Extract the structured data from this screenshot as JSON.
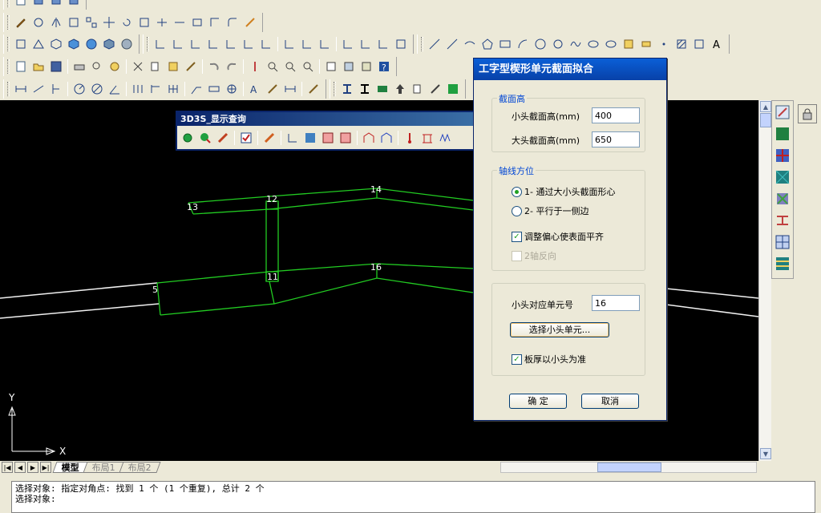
{
  "dialog": {
    "title": "工字型楔形单元截面拟合",
    "section_group": "截面高",
    "small_end_label": "小头截面高(mm)",
    "small_end_value": "400",
    "large_end_label": "大头截面高(mm)",
    "large_end_value": "650",
    "axis_group": "轴线方位",
    "radio1": "1- 通过大小头截面形心",
    "radio2": "2- 平行于一侧边",
    "check_adjust": "调整偏心使表面平齐",
    "check_reverse": "2轴反向",
    "small_unit_label": "小头对应单元号",
    "small_unit_value": "16",
    "select_button": "选择小头单元...",
    "check_thickness": "板厚以小头为准",
    "ok": "确  定",
    "cancel": "取消"
  },
  "query_toolbar": {
    "title": "3D3S_显示查询"
  },
  "drawing": {
    "node_labels": [
      "13",
      "12",
      "14",
      "11",
      "16",
      "5"
    ],
    "y_axis": "Y",
    "x_axis": "X"
  },
  "tabs": [
    "模型",
    "布局1",
    "布局2"
  ],
  "command": {
    "line1": "选择对象: 指定对角点: 找到 1 个 (1 个重复), 总计 2 个",
    "line2": "选择对象:"
  },
  "colors": {
    "canvas_bg": "#000000",
    "member_line": "#22cc22",
    "axis_line": "#ffffff",
    "title_bar": "#0a5fd7",
    "group_label": "#0046d5"
  }
}
